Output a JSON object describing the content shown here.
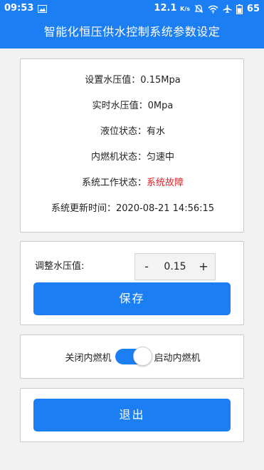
{
  "status_bar": {
    "time": "09:53",
    "speed": "12.1",
    "speed_unit": "K/s",
    "battery": "65",
    "icons": [
      "image-icon",
      "bell-muted-icon",
      "wifi-icon",
      "airplane-icon",
      "battery-icon"
    ]
  },
  "header": {
    "title": "智能化恒压供水控制系统参数设定"
  },
  "info": {
    "set_pressure": "设置水压值：0.15Mpa",
    "realtime_pressure": "实时水压值：0Mpa",
    "level_label": "液位状态：",
    "level_value": "有水",
    "engine_label": "内燃机状态：",
    "engine_value": "匀速中",
    "system_label": "系统工作状态：",
    "system_value": "系统故障",
    "updated_label": "系统更新时间：",
    "updated_value": "2020-08-21 14:56:15"
  },
  "adjust": {
    "label": "调整水压值:",
    "minus": "-",
    "value": "0.15",
    "plus": "+",
    "save_label": "保存"
  },
  "engine_switch": {
    "off_label": "关闭内燃机",
    "on_label": "启动内燃机",
    "state": "on"
  },
  "exit": {
    "label": "退出"
  },
  "colors": {
    "primary": "#1b7ef2",
    "fault": "#e0242a"
  }
}
